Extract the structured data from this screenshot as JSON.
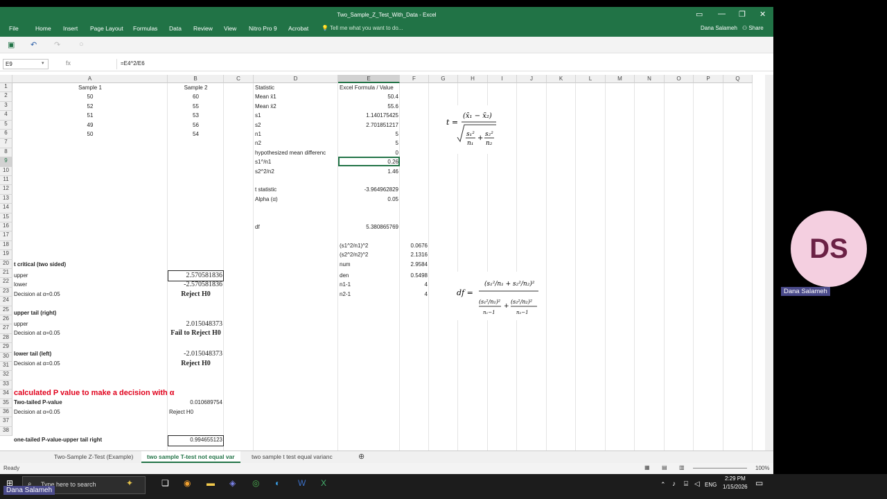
{
  "window": {
    "title": "Two_Sample_Z_Test_With_Data - Excel"
  },
  "menu": {
    "items": [
      "File",
      "Home",
      "Insert",
      "Page Layout",
      "Formulas",
      "Data",
      "Review",
      "View",
      "Nitro Pro 9",
      "Acrobat"
    ],
    "tell_me": "Tell me what you want to do...",
    "user": "Dana Salameh",
    "share": "Share"
  },
  "formula_bar": {
    "name_box": "E9",
    "fx": "fx",
    "formula": "=E4^2/E6"
  },
  "columns": [
    "A",
    "B",
    "C",
    "D",
    "E",
    "F",
    "G",
    "H",
    "I",
    "J",
    "K",
    "L",
    "M",
    "N",
    "O",
    "P",
    "Q"
  ],
  "rows": [
    "1",
    "2",
    "3",
    "4",
    "5",
    "6",
    "7",
    "8",
    "9",
    "10",
    "11",
    "12",
    "13",
    "14",
    "15",
    "16",
    "17",
    "18",
    "19",
    "20",
    "21",
    "22",
    "23",
    "24",
    "25",
    "26",
    "27",
    "28",
    "29",
    "30",
    "31",
    "32",
    "33",
    "34",
    "35",
    "36",
    "37",
    "38"
  ],
  "cells": {
    "A1": "Sample 1",
    "B1": "Sample 2",
    "D1": "Statistic",
    "E1": "Excel Formula / Value",
    "A2": "50",
    "B2": "60",
    "D2": "Mean x̄1",
    "E2": "50.4",
    "A3": "52",
    "B3": "55",
    "D3": "Mean x̄2",
    "E3": "55.6",
    "A4": "51",
    "B4": "53",
    "D4": "s1",
    "E4": "1.140175425",
    "A5": "49",
    "B5": "56",
    "D5": "s2",
    "E5": "2.701851217",
    "A6": "50",
    "B6": "54",
    "D6": "n1",
    "E6": "5",
    "D7": "n2",
    "E7": "5",
    "D8": "hypothesized mean differenc",
    "E8": "0",
    "D9": "s1^/n1",
    "E9": "0.26",
    "D10": "s2^2/n2",
    "E10": "1.46",
    "D12": "t statistic",
    "E12": "-3.964962829",
    "D13": "Alpha (α)",
    "E13": "0.05",
    "D16": "df",
    "E16": "5.380865769",
    "E18": "(s1^2/n1)^2",
    "F18": "0.0676",
    "E19": "(s2^2/n2)^2",
    "F19": "2.1316",
    "A20": "t critical (two sided)",
    "E20": "num",
    "F20": "2.9584",
    "A21": "upper",
    "B21": "2.570581836",
    "E21": "den",
    "F21": "0.5498",
    "A22": "lower",
    "B22": "-2.570581836",
    "E22": "n1-1",
    "F22": "4",
    "A23": "Decision at α=0.05",
    "B23": "Reject H0",
    "E23": "n2-1",
    "F23": "4",
    "A25": "upper tail (right)",
    "A26": "upper",
    "B26": "2.015048373",
    "A27": "Decision at α=0.05",
    "B27": "Fail to Reject H0",
    "A29": "lower  tail (left)",
    "B29": "-2.015048373",
    "A30": "Decision at α=0.05",
    "B30": "Reject H0",
    "A33": "calculated P value to make a decision with α",
    "A34": "Two-tailed P-value",
    "B34": "0.010689754",
    "A35": "Decision at α=0.05",
    "B35": "Reject H0",
    "A38": "one-tailed P-value-upper tail right",
    "B38": "0.994655123"
  },
  "sheets": [
    "Two-Sample Z-Test (Example)",
    "two sample T-test not equal var",
    "two sample t test equal varianc"
  ],
  "status": {
    "ready": "Ready",
    "zoom": "100%"
  },
  "taskbar": {
    "search": "Type here to search",
    "time": "2:29 PM",
    "date": "1/15/2026",
    "lang": "ENG"
  },
  "presenter": {
    "initials": "DS",
    "name": "Dana Salameh"
  },
  "colors": {
    "excel_green": "#217346",
    "red_text": "#e0001b"
  }
}
